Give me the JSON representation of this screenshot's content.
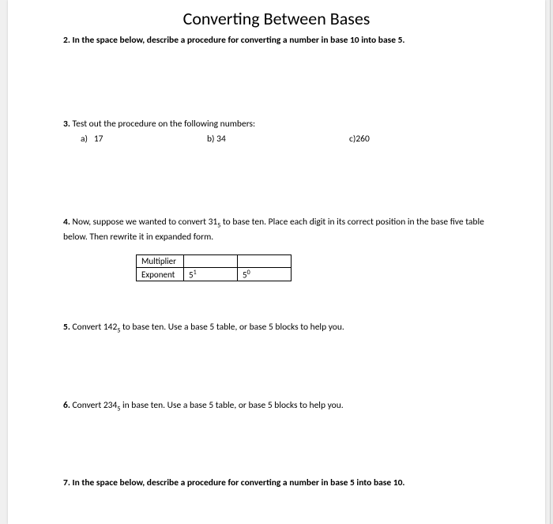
{
  "title": "Converting Between Bases",
  "q2": {
    "num": "2.",
    "text": "In the space below, describe a procedure for converting a number in base 10 into base 5."
  },
  "q3": {
    "num": "3.",
    "text": "Test out the procedure on the following numbers:",
    "a_label": "a)",
    "a_val": "17",
    "b_label": "b) 34",
    "c_label": "c)260"
  },
  "q4": {
    "num": "4.",
    "text_part1": "Now, suppose we wanted to convert 31",
    "text_sub": "5",
    "text_part2": " to base ten. Place each digit in its correct position in the base five table below. Then rewrite it in expanded form.",
    "table": {
      "row1_label": "Multiplier",
      "row1_c1": "",
      "row1_c2": "",
      "row2_label": "Exponent",
      "row2_c1_base": "5",
      "row2_c1_exp": "1",
      "row2_c2_base": "5",
      "row2_c2_exp": "0"
    }
  },
  "q5": {
    "num": "5.",
    "text_part1": "Convert 142",
    "text_sub": "5",
    "text_part2": " to base ten. Use a base 5 table, or base 5 blocks to help you."
  },
  "q6": {
    "num": "6.",
    "text_part1": "Convert 234",
    "text_sub": "5",
    "text_part2": " in base ten. Use a base 5 table, or base 5 blocks to help you."
  },
  "q7": {
    "num": "7.",
    "text": "In the space below, describe a procedure for converting a number in base 5 into base 10."
  }
}
